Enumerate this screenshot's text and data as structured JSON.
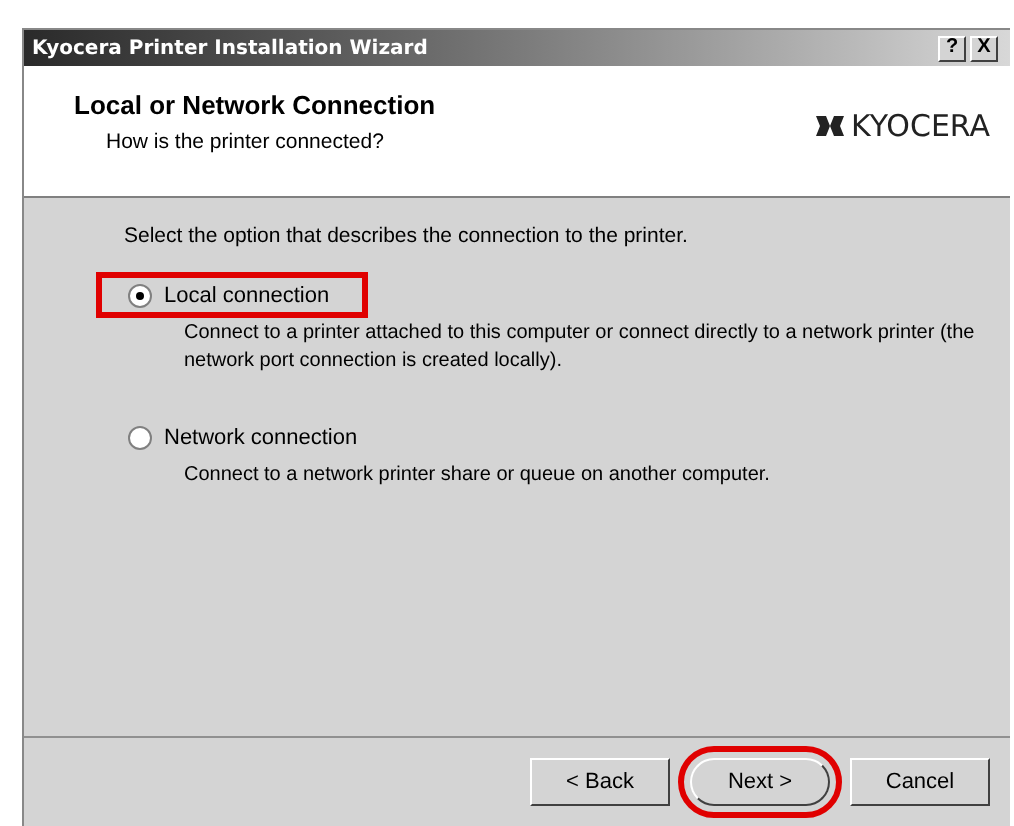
{
  "window": {
    "title": "Kyocera Printer Installation Wizard",
    "buttons": [
      {
        "label": "?"
      },
      {
        "label": "X"
      }
    ]
  },
  "header": {
    "title": "Local or Network Connection",
    "subtitle": "How is the printer connected?",
    "logo": "KYOCERA"
  },
  "instruction": "Select the option that describes the connection to the printer.",
  "options": [
    {
      "label": "Local connection",
      "selected": true,
      "highlighted": true,
      "description": "Connect to a printer attached to this computer or connect directly to a network printer (the network port connection is created locally)."
    },
    {
      "label": "Network connection",
      "selected": false,
      "highlighted": false,
      "description": "Connect to a network printer share or queue on another computer."
    }
  ],
  "buttons": [
    {
      "label": "< Back",
      "highlighted": false
    },
    {
      "label": "Next >",
      "highlighted": true
    },
    {
      "label": "Cancel",
      "highlighted": false
    }
  ]
}
